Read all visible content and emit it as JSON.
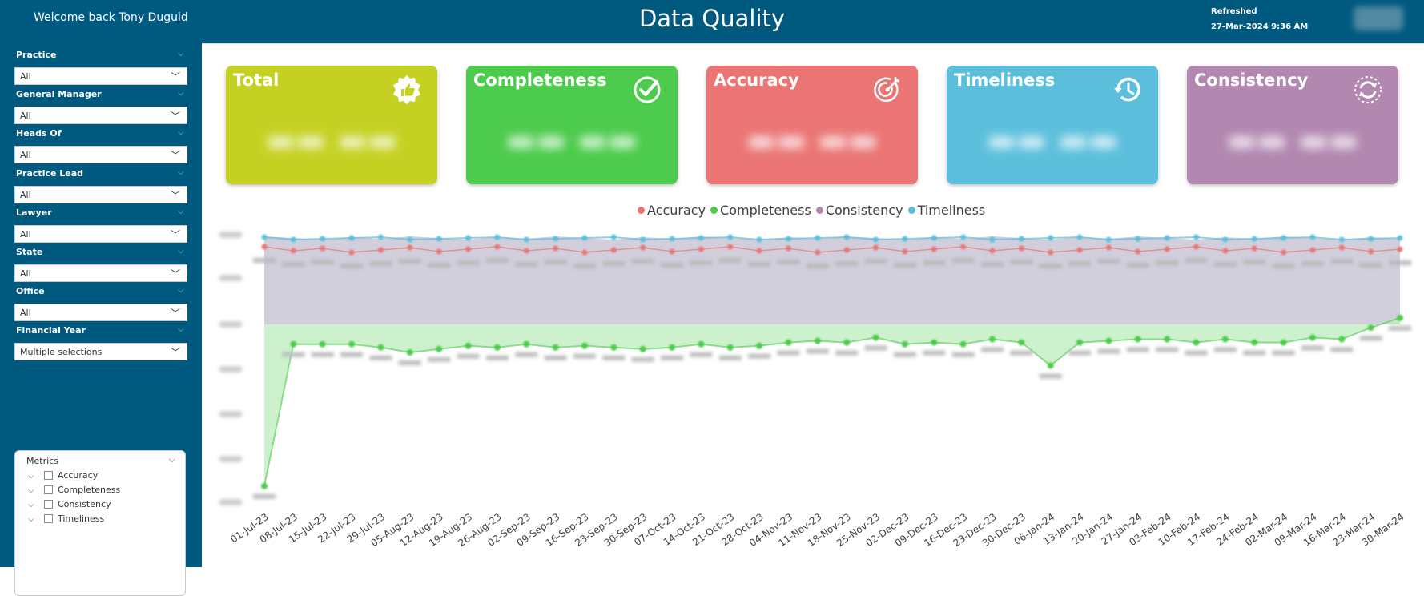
{
  "header": {
    "welcome": "Welcome back Tony Duguid",
    "title": "Data Quality",
    "refreshed_label": "Refreshed",
    "refreshed_value": "27-Mar-2024 9:36 AM"
  },
  "filters": [
    {
      "label": "Practice",
      "value": "All"
    },
    {
      "label": "General Manager",
      "value": "All"
    },
    {
      "label": "Heads Of",
      "value": "All"
    },
    {
      "label": "Practice Lead",
      "value": "All"
    },
    {
      "label": "Lawyer",
      "value": "All"
    },
    {
      "label": "State",
      "value": "All"
    },
    {
      "label": "Office",
      "value": "All"
    },
    {
      "label": "Financial Year",
      "value": "Multiple selections"
    }
  ],
  "metrics": {
    "title": "Metrics",
    "items": [
      "Accuracy",
      "Completeness",
      "Consistency",
      "Timeliness"
    ]
  },
  "cards": [
    {
      "title": "Total",
      "icon": "badge-thumbs-up-icon",
      "color": "#c5d122"
    },
    {
      "title": "Completeness",
      "icon": "check-circle-icon",
      "color": "#4ccb4c"
    },
    {
      "title": "Accuracy",
      "icon": "target-icon",
      "color": "#ea7574"
    },
    {
      "title": "Timeliness",
      "icon": "history-icon",
      "color": "#5bbfdc"
    },
    {
      "title": "Consistency",
      "icon": "refresh-circle-icon",
      "color": "#b287b0"
    }
  ],
  "chart_data": {
    "type": "area",
    "legend": [
      {
        "name": "Accuracy",
        "color": "#ea7574"
      },
      {
        "name": "Completeness",
        "color": "#4ccb4c"
      },
      {
        "name": "Consistency",
        "color": "#b287b0"
      },
      {
        "name": "Timeliness",
        "color": "#5bbfdc"
      }
    ],
    "legend_position": "top-center",
    "categories": [
      "01-Jul-23",
      "08-Jul-23",
      "15-Jul-23",
      "22-Jul-23",
      "29-Jul-23",
      "05-Aug-23",
      "12-Aug-23",
      "19-Aug-23",
      "26-Aug-23",
      "02-Sep-23",
      "09-Sep-23",
      "16-Sep-23",
      "23-Sep-23",
      "30-Sep-23",
      "07-Oct-23",
      "14-Oct-23",
      "21-Oct-23",
      "28-Oct-23",
      "04-Nov-23",
      "11-Nov-23",
      "18-Nov-23",
      "25-Nov-23",
      "02-Dec-23",
      "09-Dec-23",
      "16-Dec-23",
      "23-Dec-23",
      "30-Dec-23",
      "06-Jan-24",
      "13-Jan-24",
      "20-Jan-24",
      "27-Jan-24",
      "03-Feb-24",
      "10-Feb-24",
      "17-Feb-24",
      "24-Feb-24",
      "02-Mar-24",
      "09-Mar-24",
      "16-Mar-24",
      "23-Mar-24",
      "30-Mar-24"
    ],
    "colors": {
      "accuracy": "#ea7574",
      "completeness": "#4ccb4c",
      "consistency_fill": "#c9c7d6",
      "timeliness": "#5bbfdc"
    }
  }
}
